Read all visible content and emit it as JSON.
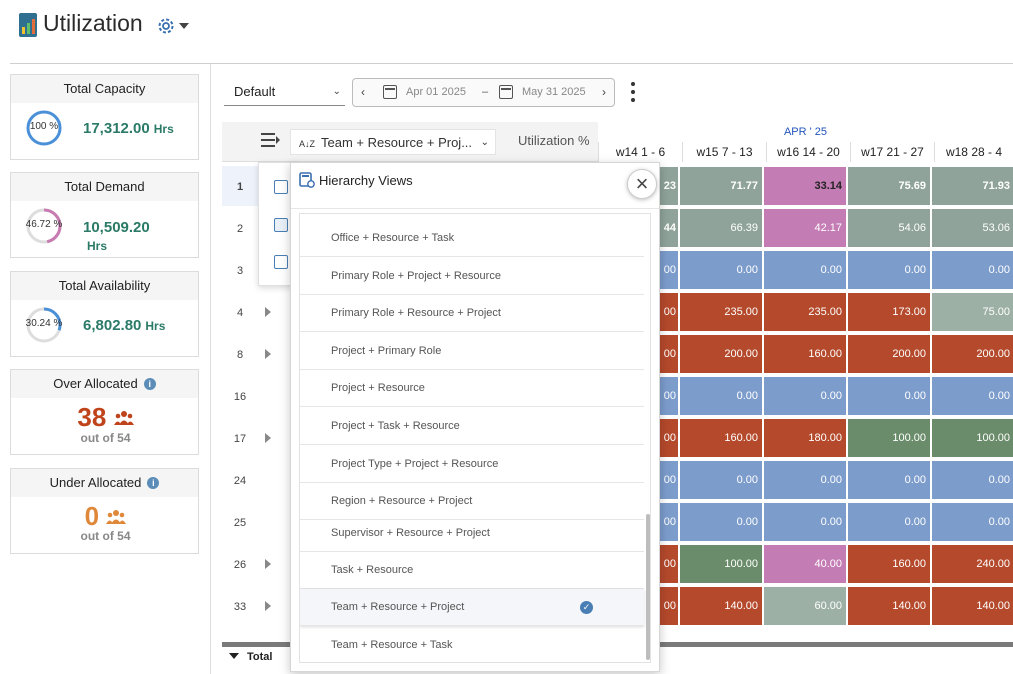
{
  "header": {
    "title": "Utilization"
  },
  "cards": {
    "capacity": {
      "title": "Total Capacity",
      "pct": "100 %",
      "pct_value": 100,
      "value": "17,312.00",
      "unit": "Hrs",
      "ring_color": "#4a90d9"
    },
    "demand": {
      "title": "Total Demand",
      "pct": "46.72 %",
      "pct_value": 46.72,
      "value": "10,509.20",
      "unit": "Hrs",
      "ring_color": "#c77bb0"
    },
    "availability": {
      "title": "Total Availability",
      "pct": "30.24 %",
      "pct_value": 30.24,
      "value": "6,802.80",
      "unit": "Hrs",
      "ring_color": "#4a90d9"
    },
    "over": {
      "title": "Over Allocated",
      "count": "38",
      "outof": "out of 54",
      "color": "#c0441b"
    },
    "under": {
      "title": "Under Allocated",
      "count": "0",
      "outof": "out of 54",
      "color": "#e0883a"
    }
  },
  "toolbar": {
    "view_select": "Default",
    "date_from": "Apr 01 2025",
    "date_sep": "–",
    "date_to": "May 31 2025"
  },
  "grid": {
    "grouping": "Team + Resource + Proj...",
    "util_header": "Utilization %",
    "month": "APR ' 25",
    "weeks": [
      "w14 1 - 6",
      "w15 7 - 13",
      "w16 14 - 20",
      "w17 21 - 27",
      "w18 28 - 4"
    ],
    "rows": [
      {
        "num": "1",
        "partial": "23",
        "cells": [
          "71.77",
          "33.14",
          "75.69",
          "71.93"
        ]
      },
      {
        "num": "2",
        "partial": "44",
        "cells": [
          "66.39",
          "42.17",
          "54.06",
          "53.06"
        ]
      },
      {
        "num": "3",
        "partial": "00",
        "cells": [
          "0.00",
          "0.00",
          "0.00",
          "0.00"
        ]
      },
      {
        "num": "4",
        "partial": "00",
        "cells": [
          "235.00",
          "235.00",
          "173.00",
          "75.00"
        ]
      },
      {
        "num": "8",
        "partial": "00",
        "cells": [
          "200.00",
          "160.00",
          "200.00",
          "200.00"
        ]
      },
      {
        "num": "16",
        "partial": "00",
        "cells": [
          "0.00",
          "0.00",
          "0.00",
          "0.00"
        ]
      },
      {
        "num": "17",
        "partial": "00",
        "cells": [
          "160.00",
          "180.00",
          "100.00",
          "100.00"
        ]
      },
      {
        "num": "24",
        "partial": "00",
        "cells": [
          "0.00",
          "0.00",
          "0.00",
          "0.00"
        ]
      },
      {
        "num": "25",
        "partial": "00",
        "cells": [
          "0.00",
          "0.00",
          "0.00",
          "0.00"
        ]
      },
      {
        "num": "26",
        "partial": "00",
        "cells": [
          "100.00",
          "40.00",
          "160.00",
          "240.00"
        ]
      },
      {
        "num": "33",
        "partial": "00",
        "cells": [
          "140.00",
          "60.00",
          "140.00",
          "140.00"
        ]
      }
    ],
    "total_label": "Total",
    "colors": {
      "gray": "#8fa39a",
      "pink": "#c47cb4",
      "blue": "#7c9ccc",
      "red": "#b5492b",
      "green": "#6a8c6a",
      "lightgray": "#9db0a6"
    }
  },
  "popup": {
    "title": "Hierarchy Views",
    "items": [
      "Office + Resource + Task",
      "Primary Role + Project + Resource",
      "Primary Role + Resource + Project",
      "Project + Primary Role",
      "Project + Resource",
      "Project + Task + Resource",
      "Project Type + Project + Resource",
      "Region + Resource + Project",
      "Supervisor + Resource + Project",
      "Task + Resource",
      "Team + Resource + Project",
      "Team + Resource + Task"
    ],
    "selected": "Team + Resource + Project"
  }
}
